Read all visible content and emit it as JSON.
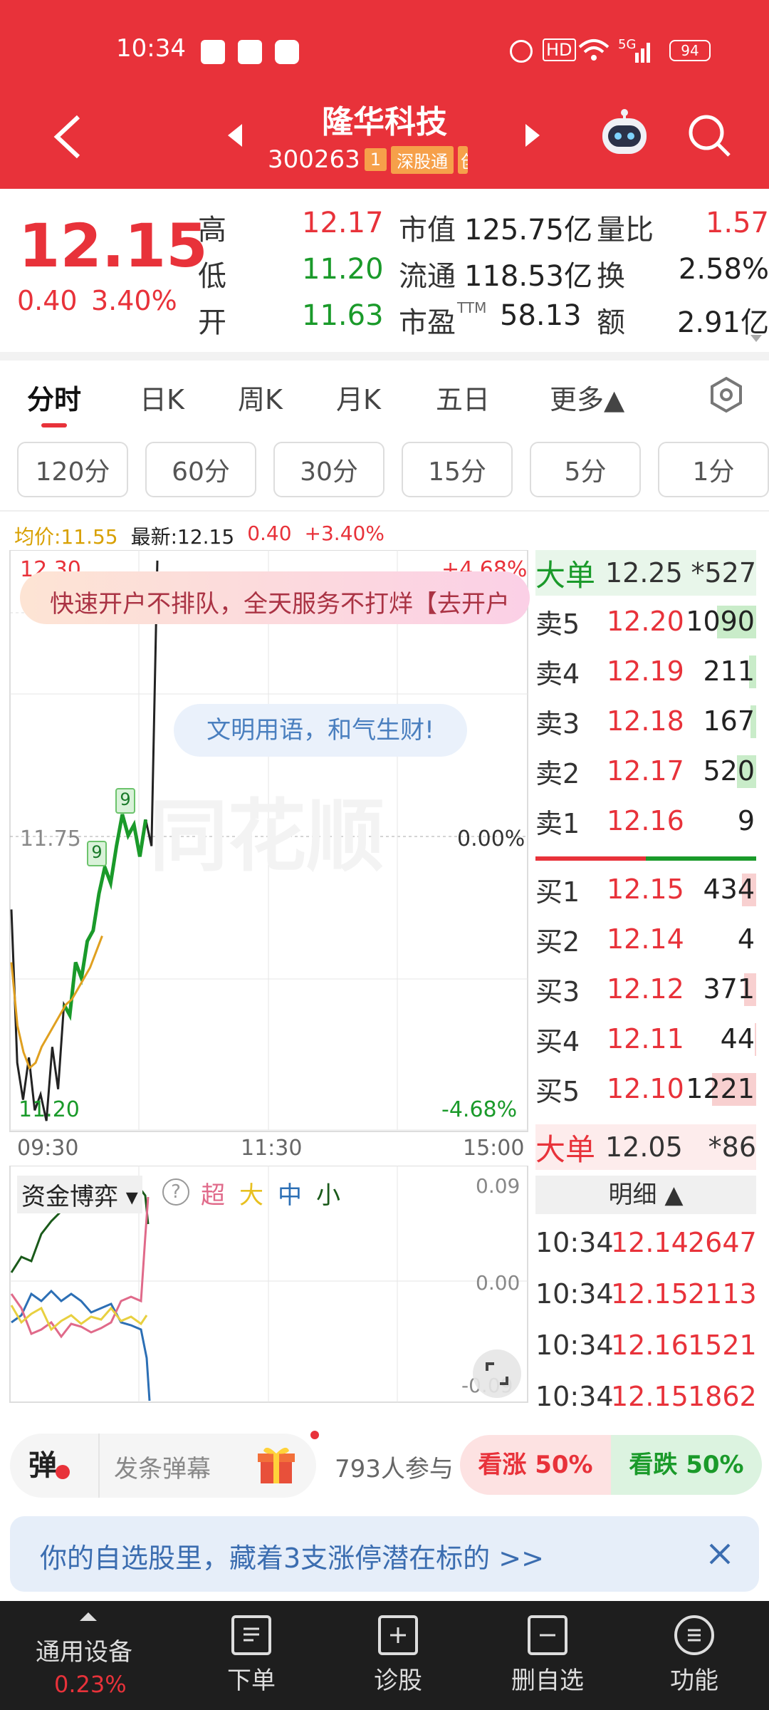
{
  "status_bar": {
    "time": "10:34",
    "hd": "HD",
    "signal": "5G",
    "battery": "94"
  },
  "header": {
    "title": "隆华科技",
    "code": "300263",
    "tag1": "1",
    "tag2": "深股通",
    "tag3": "创"
  },
  "quote": {
    "price": "12.15",
    "change": "0.40",
    "change_pct": "3.40%",
    "high_label": "高",
    "high": "12.17",
    "low_label": "低",
    "low": "11.20",
    "open_label": "开",
    "open": "11.63",
    "mcap_label": "市值",
    "mcap": "125.75亿",
    "float_label": "流通",
    "float": "118.53亿",
    "pe_label": "市盈",
    "pe_sup": "TTM",
    "pe": "58.13",
    "vr_label": "量比",
    "vr": "1.57",
    "turn_label": "换",
    "turn": "2.58%",
    "amt_label": "额",
    "amt": "2.91亿"
  },
  "tabs": [
    {
      "label": "分时"
    },
    {
      "label": "日K"
    },
    {
      "label": "周K"
    },
    {
      "label": "月K"
    },
    {
      "label": "五日"
    },
    {
      "label": "更多▲"
    }
  ],
  "periods": [
    {
      "label": "120分"
    },
    {
      "label": "60分"
    },
    {
      "label": "30分"
    },
    {
      "label": "15分"
    },
    {
      "label": "5分"
    },
    {
      "label": "1分"
    }
  ],
  "chart_info": {
    "avg": "均价:11.55",
    "latest": "最新:12.15",
    "chg": "0.40",
    "pct": "+3.40%"
  },
  "chart_labels": {
    "top_price": "12.30",
    "top_pct": "+4.68%",
    "mid_price": "11.75",
    "mid_pct": "0.00%",
    "bot_price": "11.20",
    "bot_pct": "-4.68%",
    "t1": "09:30",
    "t2": "11:30",
    "t3": "15:00",
    "ad_banner": "快速开户不排队，全天服务不打烊【去开户",
    "bubble": "文明用语，和气生财!",
    "watermark": "同花顺",
    "marker1": "9",
    "marker2": "9"
  },
  "chart_data": {
    "type": "line",
    "x_range": [
      "09:30",
      "15:00"
    ],
    "ylim": [
      11.2,
      12.3
    ],
    "series": [
      {
        "values": [
          11.62,
          11.33,
          11.26,
          11.34,
          11.24,
          11.27,
          11.22,
          11.36,
          11.28,
          11.44,
          11.42,
          11.52,
          11.49,
          11.56,
          11.58,
          11.65,
          11.7,
          11.67,
          11.74,
          11.8,
          11.76,
          11.78,
          11.72,
          11.79,
          11.74,
          12.28
        ]
      },
      {
        "values": [
          11.52,
          11.4,
          11.35,
          11.32,
          11.33,
          11.36,
          11.38,
          11.4,
          11.42,
          11.44,
          11.45,
          11.47,
          11.49,
          11.51,
          11.54,
          11.57
        ]
      }
    ]
  },
  "fund": {
    "title": "资金博弈",
    "super": "超",
    "big": "大",
    "mid": "中",
    "small": "小",
    "y_top": "0.09",
    "y_mid": "0.00",
    "y_bot": "-0.09"
  },
  "orderbook": {
    "big_sell_label": "大单",
    "big_sell_price": "12.25",
    "big_sell_vol": "*527",
    "sells": [
      {
        "label": "卖5",
        "price": "12.20",
        "vol": "1090",
        "bar": 0.55
      },
      {
        "label": "卖4",
        "price": "12.19",
        "vol": "211",
        "bar": 0.1
      },
      {
        "label": "卖3",
        "price": "12.18",
        "vol": "167",
        "bar": 0.08
      },
      {
        "label": "卖2",
        "price": "12.17",
        "vol": "520",
        "bar": 0.27
      },
      {
        "label": "卖1",
        "price": "12.16",
        "vol": "9",
        "bar": 0
      }
    ],
    "buys": [
      {
        "label": "买1",
        "price": "12.15",
        "vol": "434",
        "bar": 0.2
      },
      {
        "label": "买2",
        "price": "12.14",
        "vol": "4",
        "bar": 0
      },
      {
        "label": "买3",
        "price": "12.12",
        "vol": "371",
        "bar": 0.17
      },
      {
        "label": "买4",
        "price": "12.11",
        "vol": "44",
        "bar": 0.02
      },
      {
        "label": "买5",
        "price": "12.10",
        "vol": "1221",
        "bar": 0.62
      }
    ],
    "big_buy_label": "大单",
    "big_buy_price": "12.05",
    "big_buy_vol": "*86",
    "detail_label": "明细 ▲",
    "ticks": [
      {
        "time": "10:34",
        "price": "12.14",
        "vol": "2647"
      },
      {
        "time": "10:34",
        "price": "12.15",
        "vol": "2113"
      },
      {
        "time": "10:34",
        "price": "12.16",
        "vol": "1521"
      },
      {
        "time": "10:34",
        "price": "12.15",
        "vol": "1862"
      }
    ]
  },
  "danmu": {
    "icon": "弹",
    "placeholder": "发条弹幕",
    "participants": "793人参与",
    "up": "看涨 50%",
    "down": "看跌 50%"
  },
  "banner": {
    "text": "你的自选股里，藏着3支涨停潜在标的 >>"
  },
  "bottom_nav": {
    "device": "通用设备",
    "device_pct": "0.23%",
    "items": [
      {
        "label": "下单"
      },
      {
        "label": "诊股"
      },
      {
        "label": "删自选"
      },
      {
        "label": "功能"
      }
    ]
  }
}
